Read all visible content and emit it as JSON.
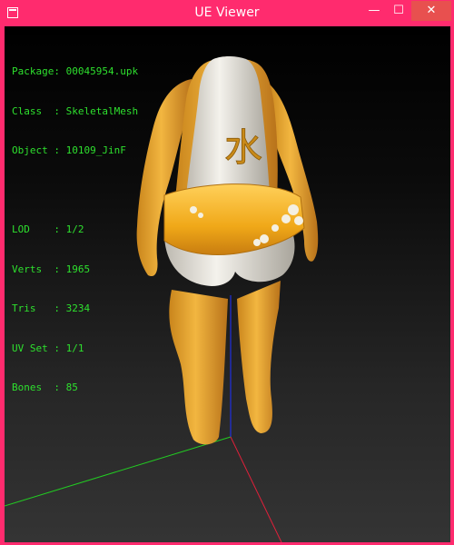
{
  "window": {
    "title": "UE Viewer",
    "accent_color": "#ff2b6e",
    "close_hover_color": "#e8504f",
    "minimize_glyph": "—",
    "maximize_glyph": "☐",
    "close_glyph": "✕"
  },
  "info": {
    "text_color": "#2ee02e",
    "package": {
      "label": "Package",
      "value": "00045954.upk"
    },
    "class": {
      "label": "Class  ",
      "value": "SkeletalMesh"
    },
    "object": {
      "label": "Object ",
      "value": "10109_JinF"
    },
    "lod": {
      "label": "LOD    ",
      "value": "1/2"
    },
    "verts": {
      "label": "Verts  ",
      "value": "1965"
    },
    "tris": {
      "label": "Tris   ",
      "value": "3234"
    },
    "uvset": {
      "label": "UV Set ",
      "value": "1/1"
    },
    "bones": {
      "label": "Bones  ",
      "value": "85"
    }
  },
  "mesh": {
    "emblem_glyph": "水",
    "body_color": "#e8a830",
    "shirt_color": "#efece4",
    "belt_color": "#f0a818"
  },
  "axes": {
    "x_color": "#e0203a",
    "y_color": "#22cc22",
    "z_color": "#2030e0"
  }
}
